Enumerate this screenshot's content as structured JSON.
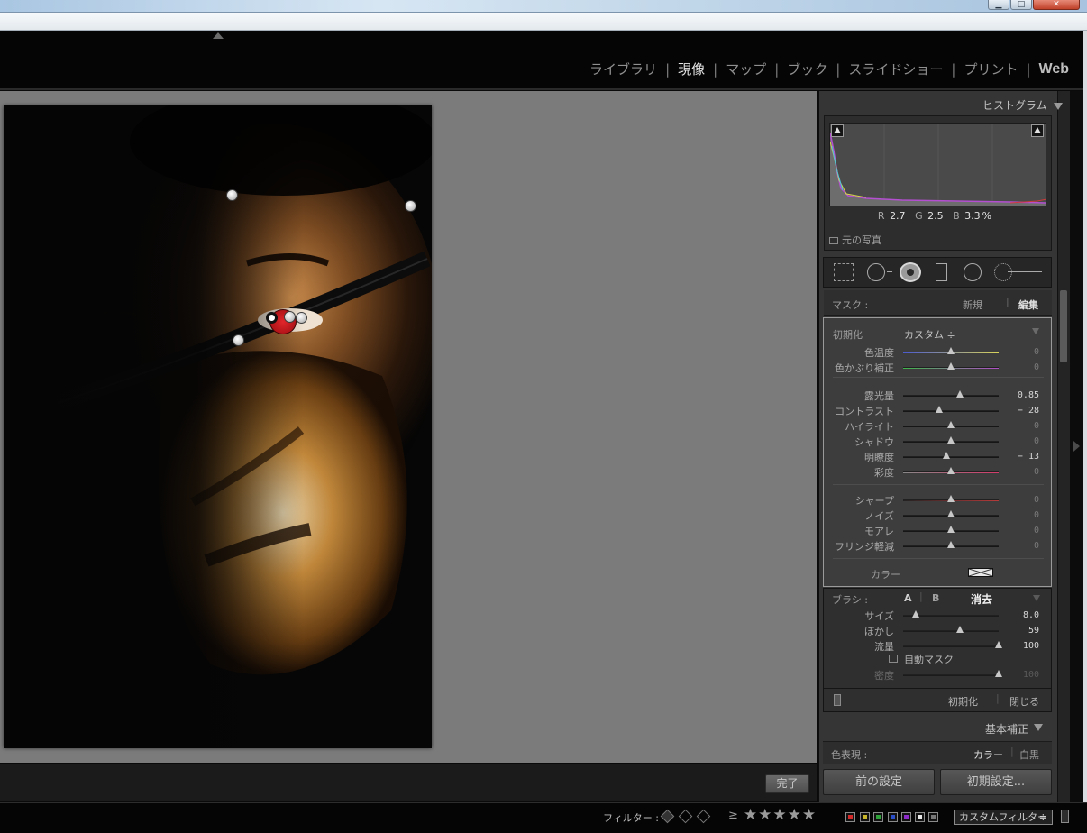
{
  "modules": [
    "ライブラリ",
    "現像",
    "マップ",
    "ブック",
    "スライドショー",
    "プリント",
    "Web"
  ],
  "active_module": "現像",
  "right_panel": {
    "histogram": {
      "title": "ヒストグラム",
      "r_label": "R",
      "r_value": "2.7",
      "g_label": "G",
      "g_value": "2.5",
      "b_label": "B",
      "b_value": "3.3",
      "unit": "%",
      "original_photo_label": "元の写真"
    },
    "mask": {
      "label": "マスク :",
      "new_label": "新規",
      "edit_label": "編集"
    },
    "effect": {
      "label": "初期化",
      "preset": "カスタム ≑"
    },
    "sliders": [
      {
        "label": "色温度",
        "value": "0",
        "pos": 0.5,
        "active": false,
        "group": 1,
        "track": "temp"
      },
      {
        "label": "色かぶり補正",
        "value": "0",
        "pos": 0.5,
        "active": false,
        "group": 1,
        "track": "tint"
      },
      {
        "label": "露光量",
        "value": "0.85",
        "pos": 0.59,
        "active": true,
        "group": 2,
        "track": "plain"
      },
      {
        "label": "コントラスト",
        "value": "− 28",
        "pos": 0.38,
        "active": true,
        "group": 2,
        "track": "plain"
      },
      {
        "label": "ハイライト",
        "value": "0",
        "pos": 0.5,
        "active": false,
        "group": 2,
        "track": "plain"
      },
      {
        "label": "シャドウ",
        "value": "0",
        "pos": 0.5,
        "active": false,
        "group": 2,
        "track": "plain"
      },
      {
        "label": "明瞭度",
        "value": "− 13",
        "pos": 0.45,
        "active": true,
        "group": 2,
        "track": "plain"
      },
      {
        "label": "彩度",
        "value": "0",
        "pos": 0.5,
        "active": false,
        "group": 2,
        "track": "sat"
      },
      {
        "label": "シャープ",
        "value": "0",
        "pos": 0.5,
        "active": false,
        "group": 3,
        "track": "red"
      },
      {
        "label": "ノイズ",
        "value": "0",
        "pos": 0.5,
        "active": false,
        "group": 3,
        "track": "plain"
      },
      {
        "label": "モアレ",
        "value": "0",
        "pos": 0.5,
        "active": false,
        "group": 3,
        "track": "plain"
      },
      {
        "label": "フリンジ軽減",
        "value": "0",
        "pos": 0.5,
        "active": false,
        "group": 3,
        "track": "plain"
      }
    ],
    "color_label": "カラー",
    "brush": {
      "label": "ブラシ :",
      "a": "A",
      "b": "B",
      "erase": "消去",
      "size_label": "サイズ",
      "size_value": "8.0",
      "size_pos": 0.13,
      "feather_label": "ぼかし",
      "feather_value": "59",
      "feather_pos": 0.59,
      "flow_label": "流量",
      "flow_value": "100",
      "flow_pos": 1.0,
      "automask_label": "自動マスク",
      "density_label": "密度",
      "density_value": "100",
      "density_pos": 1.0
    },
    "footer": {
      "reset": "初期化",
      "close": "閉じる"
    },
    "basic": {
      "title": "基本補正",
      "treatment_label": "色表現 :",
      "color": "カラー",
      "bw": "白黒"
    },
    "prev_button": "前の設定",
    "reset_button": "初期設定..."
  },
  "toolbar": {
    "done": "完了"
  },
  "filterbar": {
    "label": "フィルター :",
    "gte": "≥",
    "stars": "★★★★★",
    "custom_filter": "カスタムフィルター",
    "custom_filter_arrow": "≑"
  },
  "colors": {
    "accent_red": "#c8141a",
    "panel_bg": "#353535"
  }
}
